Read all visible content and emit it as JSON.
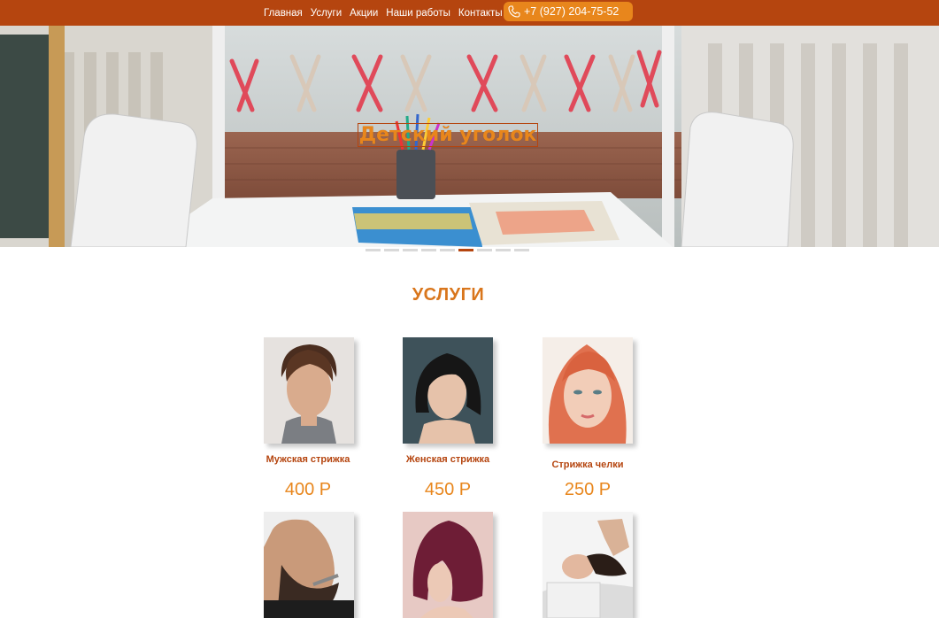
{
  "nav": {
    "items": [
      {
        "label": "Главная"
      },
      {
        "label": "Услуги"
      },
      {
        "label": "Акции"
      },
      {
        "label": "Наши работы"
      },
      {
        "label": "Контакты"
      }
    ],
    "phone": "+7 (927) 204-75-52",
    "icon": "phone-icon"
  },
  "hero": {
    "caption": "Детский уголок",
    "slide_count": 9,
    "active_slide": 6
  },
  "services": {
    "title": "УСЛУГИ",
    "items": [
      {
        "name": "Мужская стрижка",
        "price": "400 Р"
      },
      {
        "name": "Женская стрижка",
        "price": "450 Р"
      },
      {
        "name": "Стрижка челки",
        "price": "250 Р"
      },
      {
        "name": "",
        "price": ""
      },
      {
        "name": "",
        "price": ""
      },
      {
        "name": "",
        "price": ""
      }
    ]
  },
  "colors": {
    "header": "#b5450f",
    "accent": "#e8861c",
    "service_name": "#b5450f"
  }
}
